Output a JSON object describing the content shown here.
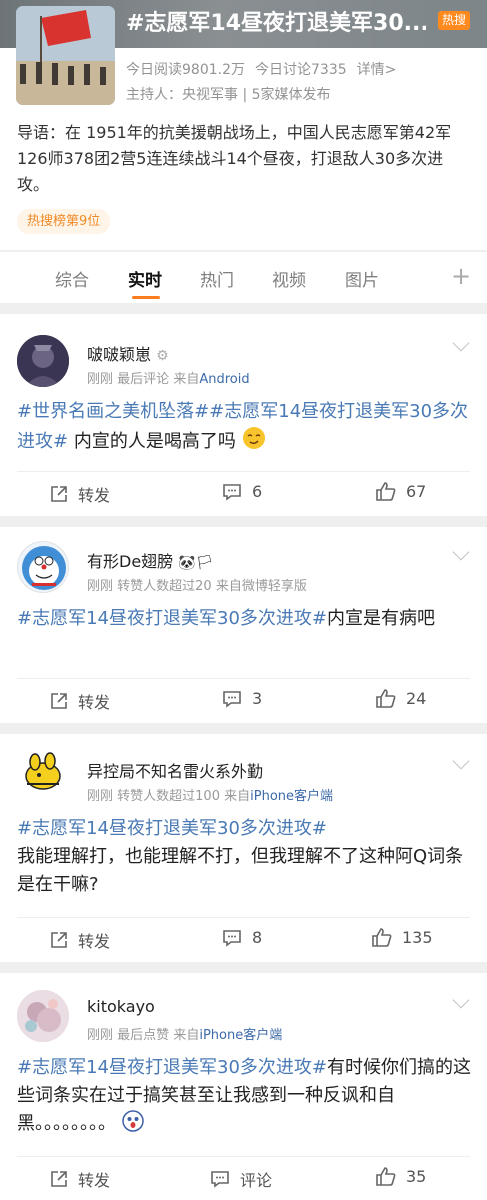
{
  "topic": {
    "title": "#志愿军14昼夜打退美军30...",
    "hot_badge": "热搜",
    "reads": "今日阅读9801.2万",
    "discussions": "今日讨论7335",
    "details_link": "详情>",
    "host": "主持人：央视军事 | 5家媒体发布",
    "intro": "导语：在 1951年的抗美援朝战场上，中国人民志愿军第42军126师378团2营5连连续战斗14个昼夜，打退敌人30多次进攻。",
    "rank_badge": "热搜榜第9位"
  },
  "tabs": [
    {
      "label": "综合"
    },
    {
      "label": "实时"
    },
    {
      "label": "热门"
    },
    {
      "label": "视频"
    },
    {
      "label": "图片"
    }
  ],
  "tab_add_symbol": "+",
  "posts": [
    {
      "user": "啵啵颖崽",
      "time": "刚刚",
      "activity": "最后评论",
      "source_prefix": "来自",
      "source": "Android",
      "tag": "#世界名画之美机坠落##志愿军14昼夜打退美军30多次进攻#",
      "text": " 内宣的人是喝高了吗",
      "repost_label": "转发",
      "comments": "6",
      "likes": "67"
    },
    {
      "user": "有形De翅膀",
      "time": "刚刚",
      "activity": "转赞人数超过20",
      "source_prefix": "来自",
      "source": "微博轻享版",
      "tag": "#志愿军14昼夜打退美军30多次进攻#",
      "text": "内宣是有病吧",
      "repost_label": "转发",
      "comments": "3",
      "likes": "24"
    },
    {
      "user": "异控局不知名雷火系外勤",
      "time": "刚刚",
      "activity": "转赞人数超过100",
      "source_prefix": "来自",
      "source": "iPhone客户端",
      "tag": "#志愿军14昼夜打退美军30多次进攻#",
      "text": "我能理解打，也能理解不打，但我理解不了这种阿Q词条是在干嘛?",
      "repost_label": "转发",
      "comments": "8",
      "likes": "135"
    },
    {
      "user": "kitokayo",
      "time": "刚刚",
      "activity": "最后点赞",
      "source_prefix": "来自",
      "source": "iPhone客户端",
      "tag": "#志愿军14昼夜打退美军30多次进攻#",
      "text": "有时候你们搞的这些词条实在过于搞笑甚至让我感到一种反讽和自黑。。。。。。。。",
      "repost_label": "转发",
      "comments": "评论",
      "likes": "35"
    }
  ]
}
